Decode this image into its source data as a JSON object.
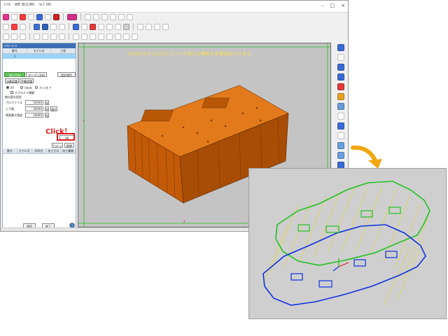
{
  "window": {
    "menu_items": [
      "ﾌｧｲﾙ",
      "WE 加工(W)",
      "ﾍﾙﾌﾟ(H)"
    ],
    "minimize_glyph": "–",
    "maximize_glyph": "□",
    "close_glyph": "×"
  },
  "panel": {
    "header_title": "ﾜｲﾔﾊﾟﾗﾒｰﾀ",
    "model_table": {
      "columns": [
        "番号",
        "モデル名",
        "工程"
      ],
      "rows": [
        [
          "1",
          "",
          ""
        ]
      ]
    },
    "tabs": [
      "加工方向",
      "オープン方向",
      "設定項目"
    ],
    "subtabs": [
      "自動認識",
      "手動認識"
    ],
    "radio_options": [
      "XY",
      "Uのみ",
      "オン/オフ"
    ],
    "checkbox_label": "テクスチャ補間",
    "section_label": "抽出面の設定",
    "fields": [
      {
        "label": "プロファイル",
        "value": "50000"
      },
      {
        "label": "上下幅",
        "value": "50000"
      },
      {
        "label": "側面最大角度",
        "value": "10000"
      }
    ],
    "field_button_glyph": "%",
    "tag_after_field": "度/ﾃ",
    "ok_label": "OK",
    "small_buttons": [
      "ﾌﾟﾚﾋﾞｭｰ",
      "削除"
    ],
    "result_columns": [
      "番号",
      "モデル名",
      "形状名",
      "加工方法",
      "加工種類"
    ],
    "footer_buttons": [
      "適用",
      "終了"
    ],
    "help_glyph": "?"
  },
  "annotation": {
    "click_label": "Click！"
  },
  "viewport": {
    "banner": "2D/3Dモデルに対してワイヤ加工の輪郭を自動抽出できます。",
    "axis_tag_left": "Y",
    "axis_tag_bottom": "X"
  },
  "colors": {
    "accent": "#e21e1e",
    "panel_header": "#3b6fb5",
    "selected_row": "#9ad3f7",
    "tab_green": "#62c25a",
    "model_orange": "#d9670e",
    "contour_green": "#24c024",
    "contour_blue": "#1030e0",
    "wire_yellow": "#e8d800"
  }
}
